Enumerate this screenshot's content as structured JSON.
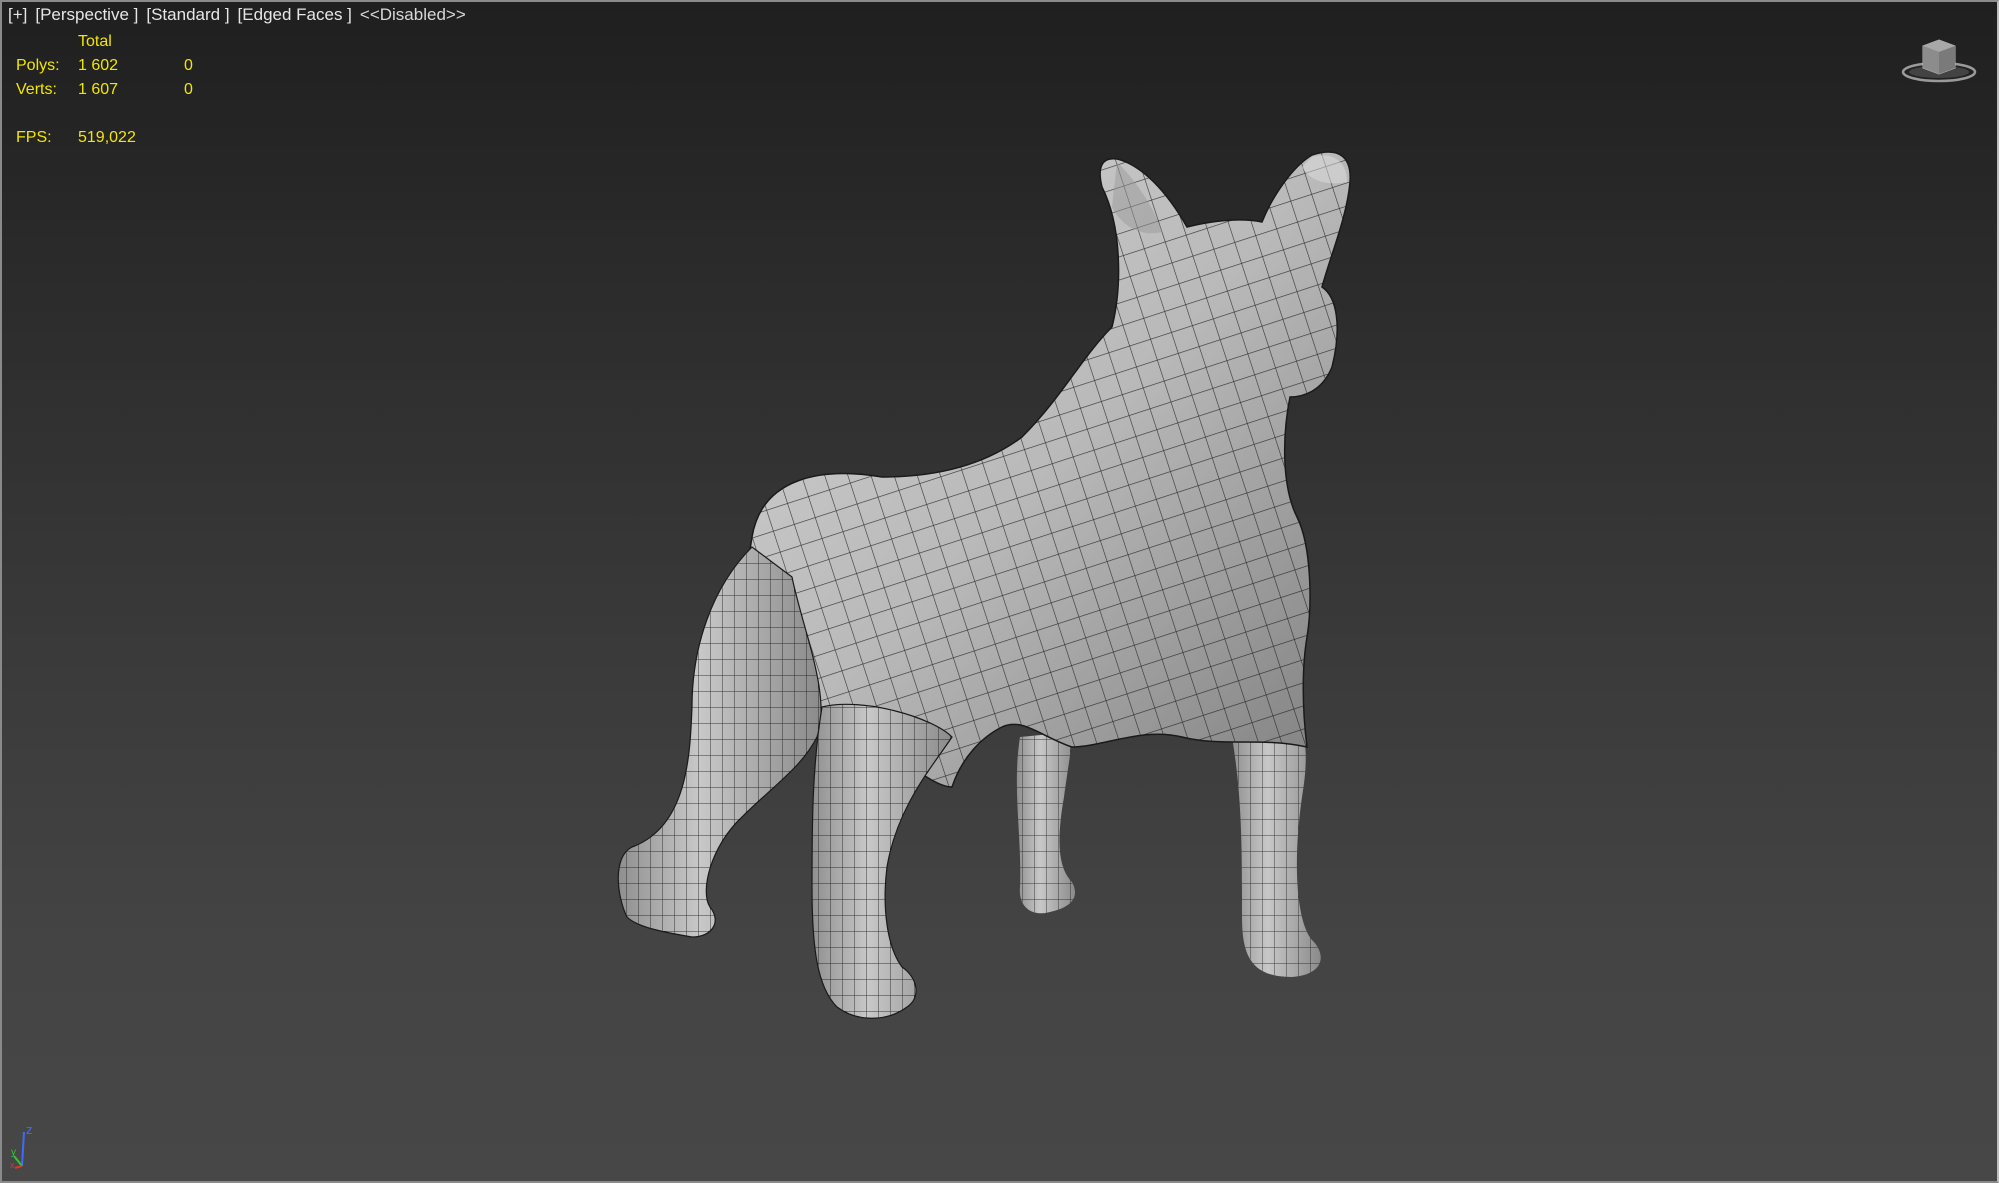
{
  "viewport": {
    "menu": {
      "plus": "[+]",
      "view": "[Perspective ]",
      "shading": "[Standard ]",
      "style": "[Edged Faces ]",
      "state": "<<Disabled>>"
    },
    "stats": {
      "header": "Total",
      "polys_label": "Polys:",
      "polys_total": "1 602",
      "polys_selected": "0",
      "verts_label": "Verts:",
      "verts_total": "1 607",
      "verts_selected": "0",
      "fps_label": "FPS:",
      "fps_value": "519,022"
    },
    "axis": {
      "z": "z",
      "y": "y",
      "x": "x"
    },
    "icons": {
      "viewcube": "viewcube-icon",
      "tripod": "axis-tripod-icon"
    },
    "colors": {
      "stats_text": "#f2e600",
      "mesh_fill": "#b8b8b8",
      "mesh_wire": "#1a1a1a",
      "background_top": "#1f1f1f",
      "background_bottom": "#474747"
    }
  }
}
